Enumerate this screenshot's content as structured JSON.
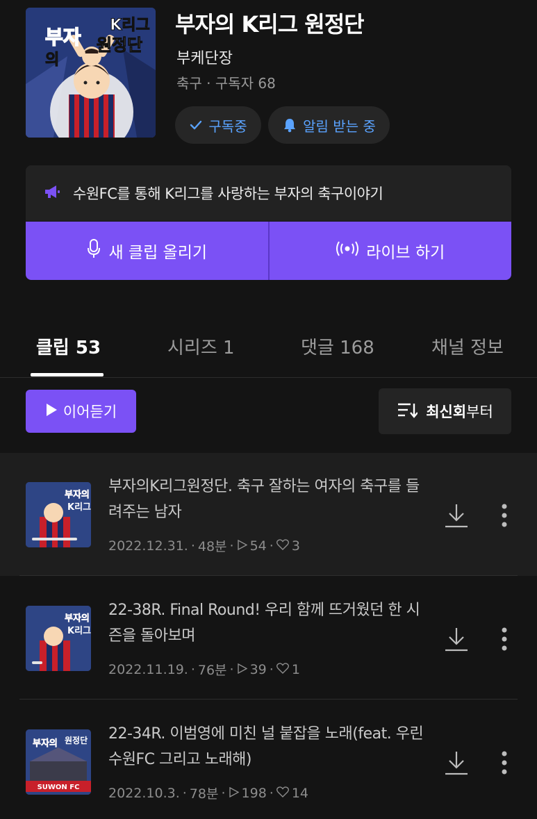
{
  "channel": {
    "title": "부자의 K리그 원정단",
    "author": "부케단장",
    "meta": "축구 · 구독자 68",
    "cover_texts": [
      "K리그",
      "부자",
      "의",
      "원정단"
    ]
  },
  "buttons": {
    "subscribe": "구독중",
    "alarm": "알림 받는 중",
    "new_clip": "새 클립 올리기",
    "live": "라이브 하기",
    "continue": "이어듣기",
    "sort_bold": "최신회",
    "sort_rest": "부터"
  },
  "description": "수원FC를 통해 K리그를 사랑하는 부자의 축구이야기",
  "tabs": [
    {
      "label": "클립 53"
    },
    {
      "label": "시리즈 1"
    },
    {
      "label": "댓글 168"
    },
    {
      "label": "채널 정보"
    }
  ],
  "clips": [
    {
      "title": "부자의K리그원정단. 축구 잘하는 여자의 축구를 들려주는 남자",
      "date": "2022.12.31.",
      "duration": "48분",
      "plays": "54",
      "likes": "3",
      "progress": 0.85
    },
    {
      "title": "22-38R. Final Round! 우리 함께 뜨거웠던 한 시즌을 돌아보며",
      "date": "2022.11.19.",
      "duration": "76분",
      "plays": "39",
      "likes": "1",
      "progress": 0.2
    },
    {
      "title": "22-34R. 이범영에 미친 널 붙잡을 노래(feat. 우린 수원FC 그리고 노래해)",
      "date": "2022.10.3.",
      "duration": "78분",
      "plays": "198",
      "likes": "14",
      "progress": 0
    }
  ],
  "colors": {
    "accent": "#7b51f5",
    "link": "#5aa3ff",
    "background": "#141414"
  },
  "icons": {
    "subscribe": "check-icon",
    "alarm": "bell-icon",
    "description": "megaphone-icon",
    "new_clip": "microphone-icon",
    "live": "broadcast-icon",
    "continue": "play-icon",
    "sort": "sort-icon",
    "download": "download-icon",
    "more": "more-vertical-icon"
  }
}
